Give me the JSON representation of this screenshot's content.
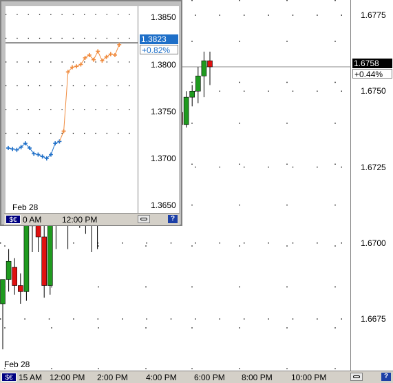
{
  "main": {
    "symbol_button": "$€",
    "date_label": "Feb 28",
    "y_ticks": [
      "1.6775",
      "1.6750",
      "1.6725",
      "1.6700",
      "1.6675"
    ],
    "x_labels": [
      "15 AM",
      "12:00 PM",
      "2:00 PM",
      "4:00 PM",
      "6:00 PM",
      "8:00 PM",
      "10:00 PM"
    ],
    "last_price": "1.6758",
    "change_pct": "+0.44%",
    "help": "?"
  },
  "inset": {
    "symbol_button": "$€",
    "date_label": "Feb 28",
    "y_ticks": [
      "1.3850",
      "1.3800",
      "1.3750",
      "1.3700",
      "1.3650"
    ],
    "x_labels": [
      "0 AM",
      "12:00 PM"
    ],
    "last_price": "1.3823",
    "change_pct": "+0.82%",
    "help": "?"
  },
  "colors": {
    "up": "#1f9a1f",
    "down": "#e01010",
    "inset_before": "#1e6fc8",
    "inset_after": "#f08a3c",
    "last_price_bg": "#000000",
    "inset_price_bg": "#1e6fc8"
  },
  "chart_data": [
    {
      "type": "candlestick",
      "title": "",
      "ylim": [
        1.6658,
        1.678
      ],
      "y_ticks": [
        1.6775,
        1.675,
        1.6725,
        1.67,
        1.6675
      ],
      "x_tick_labels": [
        "15 AM",
        "12:00 PM",
        "2:00 PM",
        "4:00 PM",
        "6:00 PM",
        "8:00 PM",
        "10:00 PM"
      ],
      "last": 1.6758,
      "candles": [
        {
          "o": 1.668,
          "h": 1.6688,
          "l": 1.6665,
          "c": 1.6688
        },
        {
          "o": 1.6688,
          "h": 1.6698,
          "l": 1.6684,
          "c": 1.6694
        },
        {
          "o": 1.6692,
          "h": 1.6695,
          "l": 1.6683,
          "c": 1.6686
        },
        {
          "o": 1.6686,
          "h": 1.669,
          "l": 1.668,
          "c": 1.6684
        },
        {
          "o": 1.6684,
          "h": 1.672,
          "l": 1.6681,
          "c": 1.6718
        },
        {
          "o": 1.6706,
          "h": 1.6714,
          "l": 1.6697,
          "c": 1.6706
        },
        {
          "o": 1.6706,
          "h": 1.6708,
          "l": 1.6697,
          "c": 1.6702
        },
        {
          "o": 1.6702,
          "h": 1.6715,
          "l": 1.6682,
          "c": 1.6686
        },
        {
          "o": 1.6686,
          "h": 1.6715,
          "l": 1.6683,
          "c": 1.6707
        },
        {
          "o": 1.6707,
          "h": 1.672,
          "l": 1.6698,
          "c": 1.6713
        },
        {
          "o": 1.6713,
          "h": 1.6725,
          "l": 1.6709,
          "c": 1.672
        },
        {
          "o": 1.672,
          "h": 1.6732,
          "l": 1.6698,
          "c": 1.6724
        },
        {
          "o": 1.6724,
          "h": 1.673,
          "l": 1.6708,
          "c": 1.6716
        },
        {
          "o": 1.6716,
          "h": 1.6729,
          "l": 1.6705,
          "c": 1.6724
        },
        {
          "o": 1.6724,
          "h": 1.6727,
          "l": 1.6703,
          "c": 1.671
        },
        {
          "o": 1.671,
          "h": 1.672,
          "l": 1.6697,
          "c": 1.6706
        },
        {
          "o": 1.6706,
          "h": 1.6722,
          "l": 1.6698,
          "c": 1.6718
        },
        {
          "o": 1.6718,
          "h": 1.6748,
          "l": 1.6716,
          "c": 1.6741
        },
        {
          "o": 1.6741,
          "h": 1.6747,
          "l": 1.6735,
          "c": 1.6737
        },
        {
          "o": 1.6737,
          "h": 1.6764,
          "l": 1.6733,
          "c": 1.6761
        },
        {
          "o": 1.6761,
          "h": 1.6763,
          "l": 1.6735,
          "c": 1.6738
        },
        {
          "o": 1.6738,
          "h": 1.6759,
          "l": 1.6734,
          "c": 1.6755
        },
        {
          "o": 1.6755,
          "h": 1.6756,
          "l": 1.6737,
          "c": 1.6738
        },
        {
          "o": 1.6738,
          "h": 1.6755,
          "l": 1.6738,
          "c": 1.6752
        },
        {
          "o": 1.6752,
          "h": 1.6758,
          "l": 1.6748,
          "c": 1.6758
        },
        {
          "o": 1.6758,
          "h": 1.6763,
          "l": 1.6752,
          "c": 1.6757
        },
        {
          "o": 1.6757,
          "h": 1.676,
          "l": 1.675,
          "c": 1.675
        },
        {
          "o": 1.6751,
          "h": 1.6755,
          "l": 1.6727,
          "c": 1.6729
        },
        {
          "o": 1.6729,
          "h": 1.6738,
          "l": 1.6725,
          "c": 1.6734
        },
        {
          "o": 1.6734,
          "h": 1.6745,
          "l": 1.6731,
          "c": 1.6743
        },
        {
          "o": 1.6743,
          "h": 1.6746,
          "l": 1.6738,
          "c": 1.6739
        },
        {
          "o": 1.6739,
          "h": 1.675,
          "l": 1.6738,
          "c": 1.6748
        },
        {
          "o": 1.6748,
          "h": 1.6752,
          "l": 1.6745,
          "c": 1.675
        },
        {
          "o": 1.675,
          "h": 1.6758,
          "l": 1.6746,
          "c": 1.6755
        },
        {
          "o": 1.6755,
          "h": 1.6763,
          "l": 1.6748,
          "c": 1.676
        },
        {
          "o": 1.676,
          "h": 1.6763,
          "l": 1.6752,
          "c": 1.6758
        }
      ]
    },
    {
      "type": "line",
      "title": "",
      "ylim": [
        1.3642,
        1.3862
      ],
      "y_ticks": [
        1.385,
        1.38,
        1.375,
        1.37,
        1.365
      ],
      "x_tick_labels": [
        "0 AM",
        "12:00 PM"
      ],
      "last": 1.3823,
      "series": [
        {
          "values": [
            1.3711,
            1.371,
            1.3709,
            1.3712,
            1.3716,
            1.3711,
            1.3705,
            1.3704,
            1.3702,
            1.37,
            1.3704,
            1.3716,
            1.3718
          ]
        },
        {
          "values": [
            1.3729,
            1.3792,
            1.3797,
            1.3798,
            1.38,
            1.3807,
            1.381,
            1.3805,
            1.3814,
            1.3804,
            1.3808,
            1.3811,
            1.381,
            1.3821
          ]
        }
      ]
    }
  ]
}
